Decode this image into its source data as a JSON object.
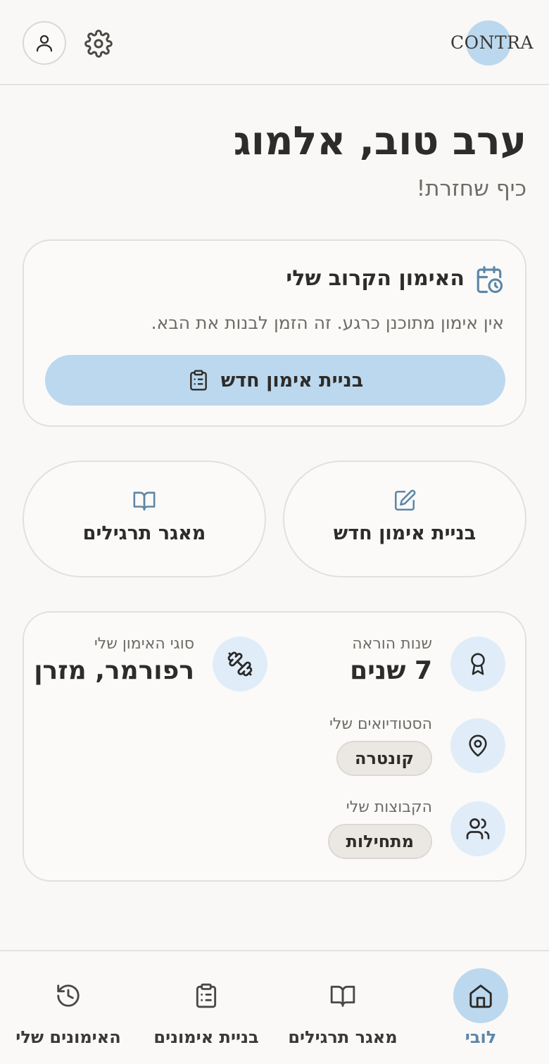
{
  "header": {
    "logo_text": "CONTRA",
    "profile_icon": "user-icon",
    "settings_icon": "gear-icon"
  },
  "greeting": {
    "title": "ערב טוב, אלמוג",
    "subtitle": "כיף שחזרת!"
  },
  "upcoming": {
    "title": "האימון הקרוב שלי",
    "description": "אין אימון מתוכנן כרגע. זה הזמן לבנות את הבא.",
    "button_label": "בניית אימון חדש",
    "icon": "calendar-clock-icon",
    "button_icon": "clipboard-list-icon"
  },
  "quick_actions": [
    {
      "label": "בניית אימון חדש",
      "icon": "edit-icon"
    },
    {
      "label": "מאגר תרגילים",
      "icon": "book-open-icon"
    }
  ],
  "info": {
    "teaching_years": {
      "label": "שנות הוראה",
      "value": "7 שנים",
      "icon": "award-icon"
    },
    "training_types": {
      "label": "סוגי האימון שלי",
      "value": "רפורמר, מזרן",
      "icon": "dumbbell-icon"
    },
    "studios": {
      "label": "הסטודיואים שלי",
      "chips": [
        "קונטרה"
      ],
      "icon": "map-pin-icon"
    },
    "groups": {
      "label": "הקבוצות שלי",
      "chips": [
        "מתחילות"
      ],
      "icon": "users-icon"
    }
  },
  "bottom_nav": [
    {
      "label": "לובי",
      "icon": "home-icon",
      "active": true
    },
    {
      "label": "מאגר תרגילים",
      "icon": "book-open-icon",
      "active": false
    },
    {
      "label": "בניית אימונים",
      "icon": "clipboard-list-icon",
      "active": false
    },
    {
      "label": "האימונים שלי",
      "icon": "history-icon",
      "active": false
    }
  ],
  "colors": {
    "accent": "#bcd8ee",
    "accent_dark": "#5d86a8",
    "background": "#f9f8f6",
    "circle_bg": "#e0edf8",
    "chip_bg": "#ebe8e4"
  }
}
